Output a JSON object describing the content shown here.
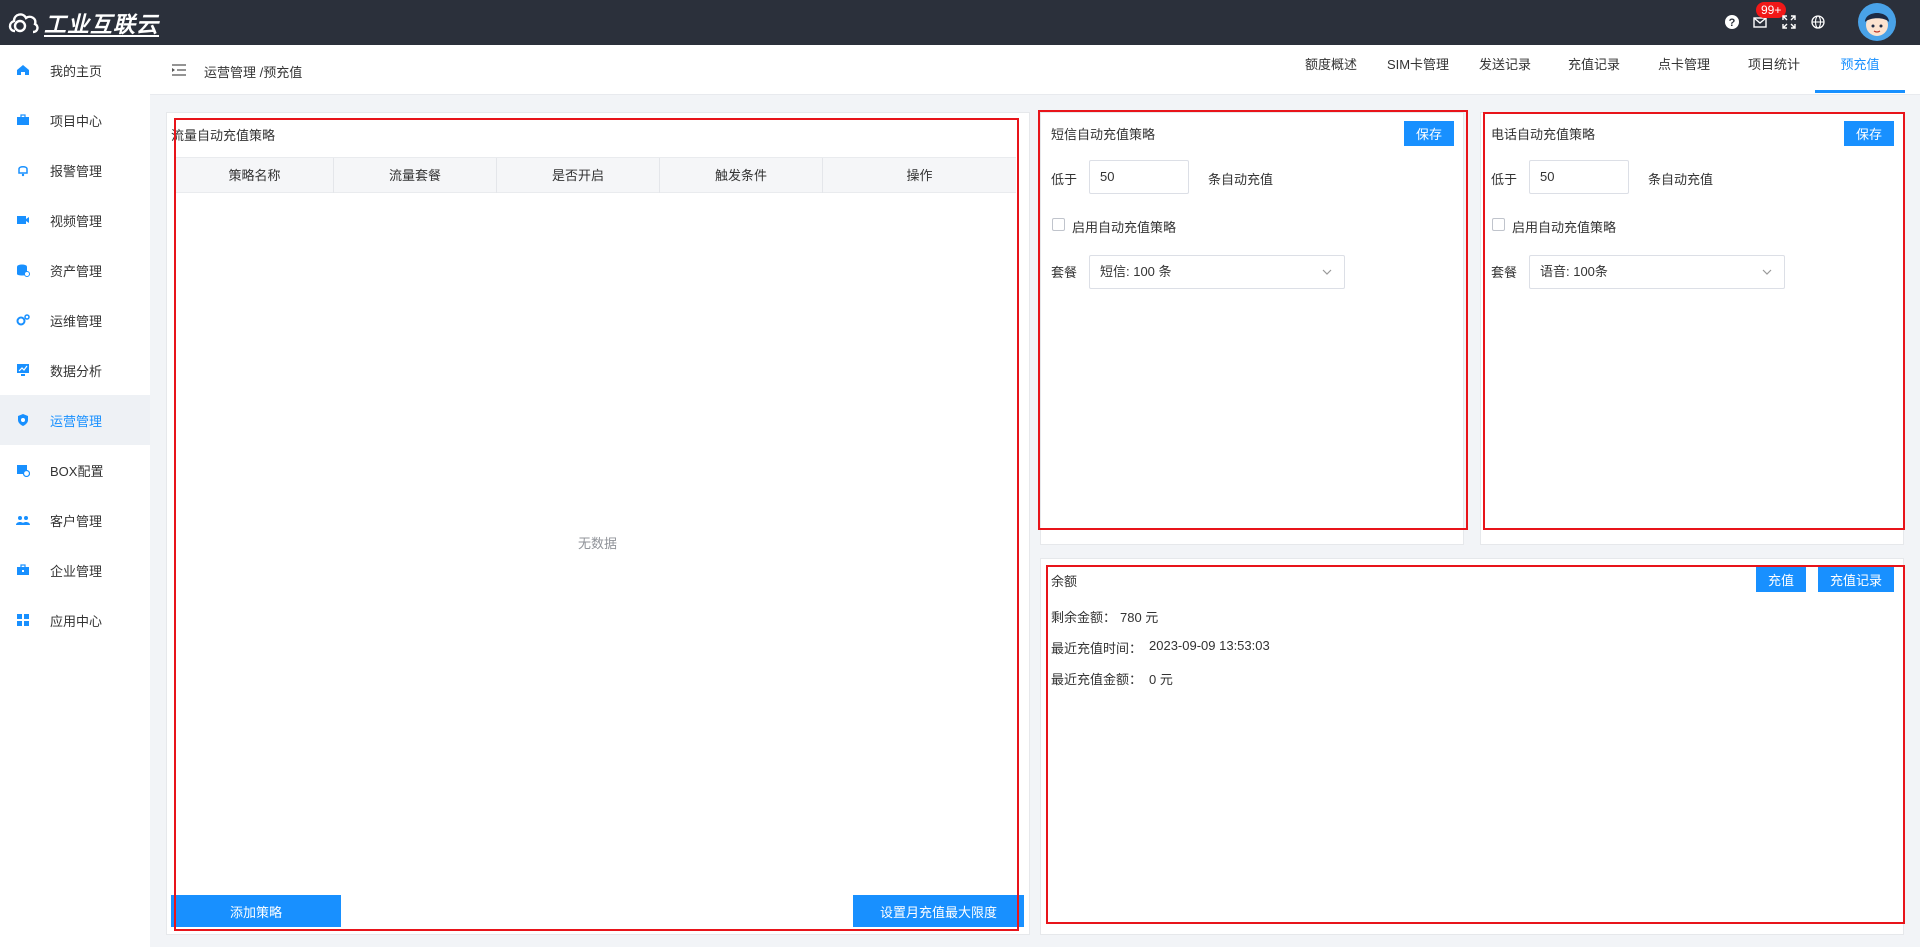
{
  "app": {
    "logo_text": "工业互联云"
  },
  "topbar": {
    "notification_count": "99+"
  },
  "sidebar": {
    "items": [
      {
        "label": "我的主页",
        "icon": "home-icon"
      },
      {
        "label": "项目中心",
        "icon": "briefcase-icon"
      },
      {
        "label": "报警管理",
        "icon": "bell-icon"
      },
      {
        "label": "视频管理",
        "icon": "video-icon"
      },
      {
        "label": "资产管理",
        "icon": "database-icon"
      },
      {
        "label": "运维管理",
        "icon": "gears-icon"
      },
      {
        "label": "数据分析",
        "icon": "monitor-chart-icon"
      },
      {
        "label": "运营管理",
        "icon": "shield-gear-icon"
      },
      {
        "label": "BOX配置",
        "icon": "box-config-icon"
      },
      {
        "label": "客户管理",
        "icon": "users-icon"
      },
      {
        "label": "企业管理",
        "icon": "toolbox-icon"
      },
      {
        "label": "应用中心",
        "icon": "apps-icon"
      }
    ],
    "active_index": 7
  },
  "header": {
    "breadcrumb": "运营管理 /预充值",
    "tabs": [
      "额度概述",
      "SIM卡管理",
      "发送记录",
      "充值记录",
      "点卡管理",
      "项目统计",
      "预充值"
    ],
    "active_tab": 6
  },
  "flow": {
    "title": "流量自动充值策略",
    "columns": [
      "策略名称",
      "流量套餐",
      "是否开启",
      "触发条件",
      "操作"
    ],
    "empty_text": "无数据",
    "add_button": "添加策略",
    "limit_button": "设置月充值最大限度"
  },
  "sms": {
    "title": "短信自动充值策略",
    "save": "保存",
    "below_label": "低于",
    "threshold": "50",
    "suffix": "条自动充值",
    "enable_label": "启用自动充值策略",
    "package_label": "套餐",
    "package_value": "短信: 100 条"
  },
  "phone": {
    "title": "电话自动充值策略",
    "save": "保存",
    "below_label": "低于",
    "threshold": "50",
    "suffix": "条自动充值",
    "enable_label": "启用自动充值策略",
    "package_label": "套餐",
    "package_value": "语音: 100条"
  },
  "balance": {
    "title": "余额",
    "recharge_button": "充值",
    "records_button": "充值记录",
    "remaining_label": "剩余金额：",
    "remaining_value": "780 元",
    "last_time_label": "最近充值时间：",
    "last_time_value": "2023-09-09 13:53:03",
    "last_amount_label": "最近充值金额：",
    "last_amount_value": "0 元"
  },
  "colors": {
    "accent": "#1890ff",
    "topbar": "#2b303b",
    "highlight": "#e8141a"
  }
}
